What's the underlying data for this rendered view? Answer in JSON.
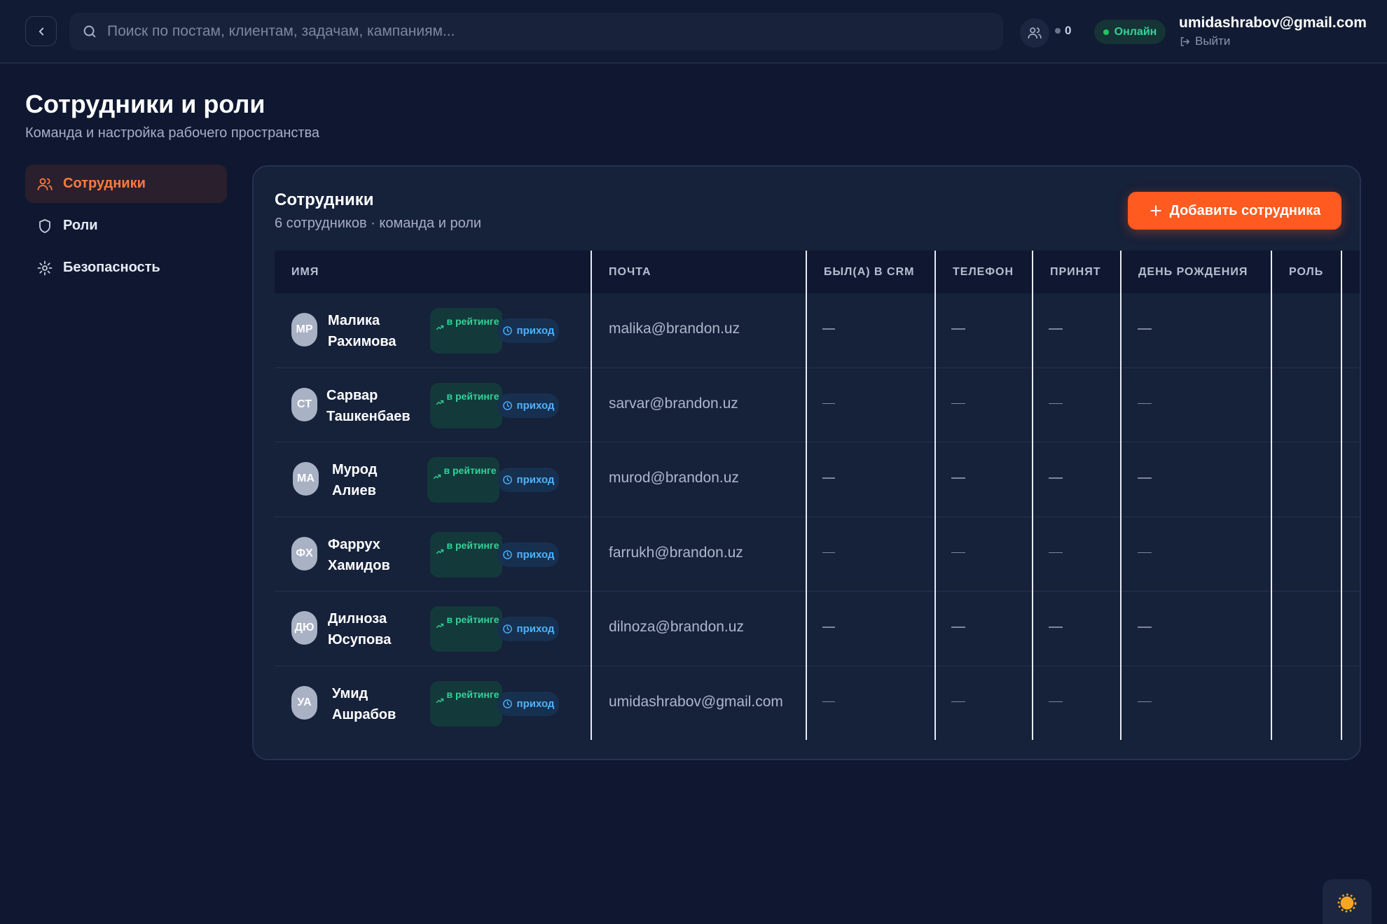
{
  "header": {
    "search_placeholder": "Поиск по постам, клиентам, задачам, кампаниям...",
    "users_count": "0",
    "status": "Онлайн",
    "user_email": "umidashrabov@gmail.com",
    "logout": "Выйти"
  },
  "page": {
    "title": "Сотрудники и роли",
    "subtitle": "Команда и настройка рабочего пространства"
  },
  "sidebar": {
    "items": [
      {
        "label": "Сотрудники",
        "icon": "users-icon",
        "active": true
      },
      {
        "label": "Роли",
        "icon": "shield-icon",
        "active": false
      },
      {
        "label": "Безопасность",
        "icon": "gear-icon",
        "active": false
      }
    ]
  },
  "card": {
    "title": "Сотрудники",
    "subtitle": "6 сотрудников · команда и роли",
    "add_button": "Добавить сотрудника"
  },
  "table": {
    "columns": [
      "ИМЯ",
      "ПОЧТА",
      "БЫЛ(А) В CRM",
      "ТЕЛЕФОН",
      "ПРИНЯТ",
      "ДЕНЬ РОЖДЕНИЯ",
      "РОЛЬ"
    ],
    "badge_rating": "в рейтинге",
    "badge_arrival": "приход",
    "empty": "—",
    "rows": [
      {
        "initials": "МР",
        "first": "Малика",
        "last": "Рахимова",
        "email": "malika@brandon.uz",
        "crm": "—",
        "phone": "—",
        "hired": "—",
        "birthday": "—",
        "role": ""
      },
      {
        "initials": "СТ",
        "first": "Сарвар",
        "last": "Ташкенбаев",
        "email": "sarvar@brandon.uz",
        "crm": "—",
        "phone": "—",
        "hired": "—",
        "birthday": "—",
        "role": ""
      },
      {
        "initials": "МА",
        "first": "Мурод",
        "last": "Алиев",
        "email": "murod@brandon.uz",
        "crm": "—",
        "phone": "—",
        "hired": "—",
        "birthday": "—",
        "role": ""
      },
      {
        "initials": "ФХ",
        "first": "Фаррух",
        "last": "Хамидов",
        "email": "farrukh@brandon.uz",
        "crm": "—",
        "phone": "—",
        "hired": "—",
        "birthday": "—",
        "role": ""
      },
      {
        "initials": "ДЮ",
        "first": "Дилноза",
        "last": "Юсупова",
        "email": "dilnoza@brandon.uz",
        "crm": "—",
        "phone": "—",
        "hired": "—",
        "birthday": "—",
        "role": ""
      },
      {
        "initials": "УА",
        "first": "Умид",
        "last": "Ашрабов",
        "email": "umidashrabov@gmail.com",
        "crm": "—",
        "phone": "—",
        "hired": "—",
        "birthday": "—",
        "role": ""
      }
    ]
  },
  "colors": {
    "background": "#0f1830",
    "card": "#16213a",
    "accent": "#ff5a1f",
    "online": "#22c55e",
    "rating": "#34d399",
    "arrival": "#4fb2ff"
  },
  "floating": {
    "theme_toggle_icon": "sun-icon"
  }
}
